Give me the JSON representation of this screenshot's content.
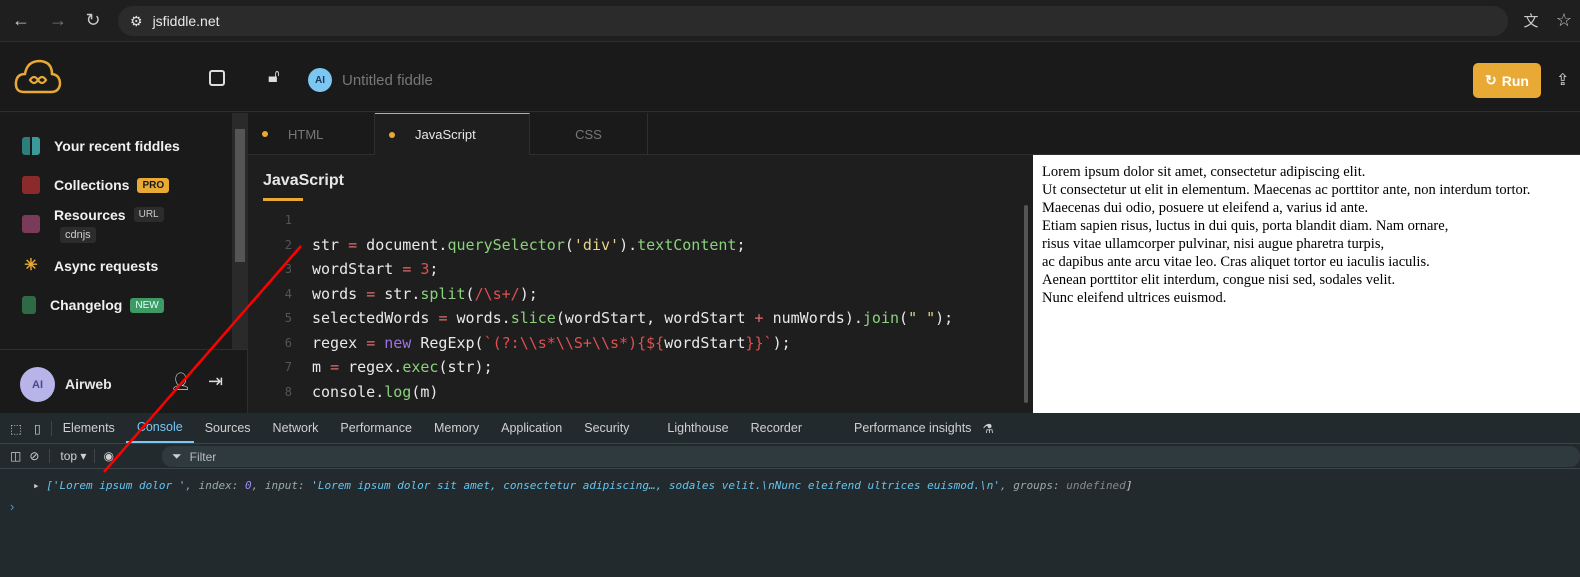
{
  "browser": {
    "url": "jsfiddle.net"
  },
  "header": {
    "avatar": "AI",
    "title": "Untitled fiddle",
    "run": "Run"
  },
  "sidebar": {
    "items": [
      {
        "label": "Your recent fiddles"
      },
      {
        "label": "Collections",
        "badge": "PRO"
      },
      {
        "label": "Resources",
        "badge": "URL",
        "sub": "cdnjs"
      },
      {
        "label": "Async requests"
      },
      {
        "label": "Changelog",
        "badge": "NEW"
      }
    ],
    "user": {
      "avatar": "AI",
      "name": "Airweb"
    }
  },
  "tabs": [
    "HTML",
    "JavaScript",
    "CSS"
  ],
  "editor": {
    "title": "JavaScript",
    "line_numbers": [
      "1",
      "2",
      "3",
      "4",
      "5",
      "6",
      "7",
      "8"
    ]
  },
  "result": {
    "lines": [
      "Lorem ipsum dolor sit amet, consectetur adipiscing elit.",
      "Ut consectetur ut elit in elementum. Maecenas ac porttitor ante, non interdum tortor.",
      "Maecenas dui odio, posuere ut eleifend a, varius id ante.",
      "Etiam sapien risus, luctus in dui quis, porta blandit diam. Nam ornare,",
      "risus vitae ullamcorper pulvinar, nisi augue pharetra turpis,",
      "ac dapibus ante arcu vitae leo. Cras aliquet tortor eu iaculis iaculis.",
      "Aenean porttitor elit interdum, congue nisi sed, sodales velit.",
      "Nunc eleifend ultrices euismod."
    ]
  },
  "devtools": {
    "tabs": [
      "Elements",
      "Console",
      "Sources",
      "Network",
      "Performance",
      "Memory",
      "Application",
      "Security",
      "Lighthouse",
      "Recorder",
      "Performance insights"
    ],
    "context": "top",
    "filter": "Filter",
    "log": {
      "match": "'Lorem ipsum dolor '",
      "index_key": "index",
      "index_val": "0",
      "input_key": "input",
      "input_val": "'Lorem ipsum dolor sit amet, consectetur adipiscing…, sodales velit.\\nNunc eleifend ultrices euismod.\\n'",
      "groups_key": "groups",
      "groups_val": "undefined"
    }
  }
}
